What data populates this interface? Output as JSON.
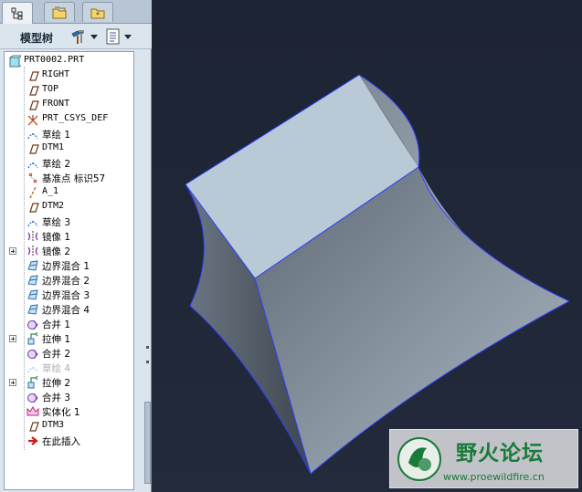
{
  "panel": {
    "tabs": [
      {
        "name": "model-tree-tab",
        "icon": "model-tree-icon",
        "active": true
      },
      {
        "name": "layers-tab",
        "icon": "folder-icon",
        "active": false
      },
      {
        "name": "favorites-tab",
        "icon": "favorites-folder-icon",
        "active": false
      }
    ],
    "title": "模型树",
    "settings_icon": "tools-icon",
    "show_icon": "list-icon"
  },
  "tree": {
    "items": [
      {
        "label": "PRT0002.PRT",
        "icon": "part-icon",
        "level": 0,
        "mono": true
      },
      {
        "label": "RIGHT",
        "icon": "datum-plane-icon",
        "level": 1,
        "mono": true
      },
      {
        "label": "TOP",
        "icon": "datum-plane-icon",
        "level": 1,
        "mono": true
      },
      {
        "label": "FRONT",
        "icon": "datum-plane-icon",
        "level": 1,
        "mono": true
      },
      {
        "label": "PRT_CSYS_DEF",
        "icon": "csys-icon",
        "level": 1,
        "mono": true
      },
      {
        "label": "草绘 1",
        "icon": "sketch-icon",
        "level": 1
      },
      {
        "label": "DTM1",
        "icon": "datum-plane-icon",
        "level": 1,
        "mono": true
      },
      {
        "label": "草绘 2",
        "icon": "sketch-icon",
        "level": 1
      },
      {
        "label": "基准点 标识57",
        "icon": "datum-point-icon",
        "level": 1
      },
      {
        "label": "A_1",
        "icon": "datum-axis-icon",
        "level": 1,
        "mono": true
      },
      {
        "label": "DTM2",
        "icon": "datum-plane-icon",
        "level": 1,
        "mono": true
      },
      {
        "label": "草绘 3",
        "icon": "sketch-icon",
        "level": 1
      },
      {
        "label": "镜像 1",
        "icon": "mirror-icon",
        "level": 1
      },
      {
        "label": "镜像 2",
        "icon": "mirror-icon",
        "level": 1,
        "expandable": true
      },
      {
        "label": "边界混合 1",
        "icon": "boundary-blend-icon",
        "level": 1
      },
      {
        "label": "边界混合 2",
        "icon": "boundary-blend-icon",
        "level": 1
      },
      {
        "label": "边界混合 3",
        "icon": "boundary-blend-icon",
        "level": 1
      },
      {
        "label": "边界混合 4",
        "icon": "boundary-blend-icon",
        "level": 1
      },
      {
        "label": "合并 1",
        "icon": "merge-icon",
        "level": 1
      },
      {
        "label": "拉伸 1",
        "icon": "extrude-icon",
        "level": 1,
        "expandable": true
      },
      {
        "label": "合并 2",
        "icon": "merge-icon",
        "level": 1
      },
      {
        "label": "草绘 4",
        "icon": "sketch-icon",
        "level": 1,
        "suppressed": true
      },
      {
        "label": "拉伸 2",
        "icon": "extrude-icon",
        "level": 1,
        "expandable": true
      },
      {
        "label": "合并 3",
        "icon": "merge-icon",
        "level": 1
      },
      {
        "label": "实体化 1",
        "icon": "solidify-icon",
        "level": 1
      },
      {
        "label": "DTM3",
        "icon": "datum-plane-icon",
        "level": 1,
        "mono": true
      },
      {
        "label": "在此插入",
        "icon": "insert-here-arrow-icon",
        "level": 1
      }
    ]
  },
  "watermark": {
    "title": "野火论坛",
    "url": "www.proewildfire.cn",
    "logo_icon": "wildfire-logo-icon"
  },
  "colors": {
    "viewport_bg": "#1e2535",
    "face_top": "#b9c9d6",
    "edge": "#2a3cff"
  }
}
